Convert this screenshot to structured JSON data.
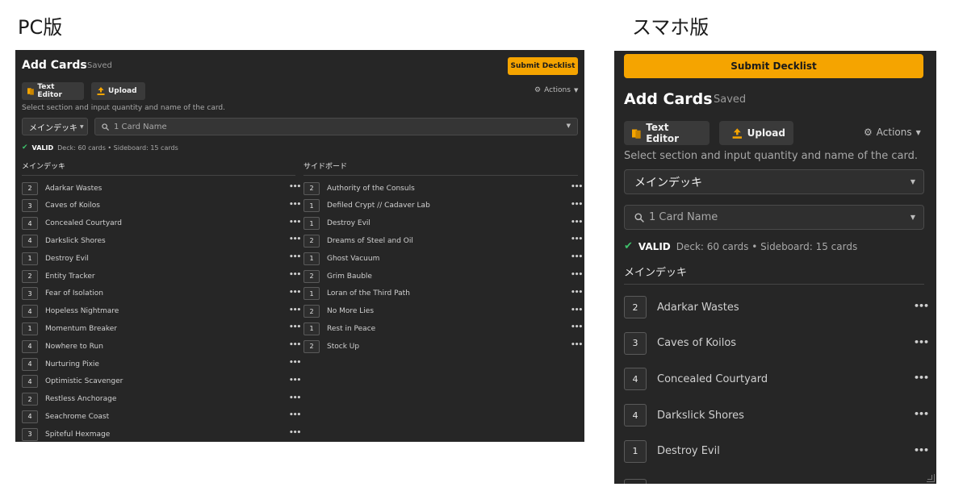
{
  "captions": {
    "pc": "PC版",
    "sp": "スマホ版"
  },
  "pc": {
    "title": "Add Cards",
    "saved": "Saved",
    "submit_label": "Submit Decklist",
    "text_editor_label": "Text Editor",
    "upload_label": "Upload",
    "actions_label": "Actions",
    "hint": "Select section and input quantity and name of the card.",
    "section_select": "メインデッキ",
    "search_placeholder": "1 Card Name",
    "valid_label": "VALID",
    "deck_info": "Deck: 60 cards • Sideboard: 15 cards",
    "main_heading": "メインデッキ",
    "side_heading": "サイドボード",
    "main_cards": [
      {
        "qty": "2",
        "name": "Adarkar Wastes"
      },
      {
        "qty": "3",
        "name": "Caves of Koilos"
      },
      {
        "qty": "4",
        "name": "Concealed Courtyard"
      },
      {
        "qty": "4",
        "name": "Darkslick Shores"
      },
      {
        "qty": "1",
        "name": "Destroy Evil"
      },
      {
        "qty": "2",
        "name": "Entity Tracker"
      },
      {
        "qty": "3",
        "name": "Fear of Isolation"
      },
      {
        "qty": "4",
        "name": "Hopeless Nightmare"
      },
      {
        "qty": "1",
        "name": "Momentum Breaker"
      },
      {
        "qty": "4",
        "name": "Nowhere to Run"
      },
      {
        "qty": "4",
        "name": "Nurturing Pixie"
      },
      {
        "qty": "4",
        "name": "Optimistic Scavenger"
      },
      {
        "qty": "2",
        "name": "Restless Anchorage"
      },
      {
        "qty": "4",
        "name": "Seachrome Coast"
      },
      {
        "qty": "3",
        "name": "Spiteful Hexmage"
      }
    ],
    "side_cards": [
      {
        "qty": "2",
        "name": "Authority of the Consuls"
      },
      {
        "qty": "1",
        "name": "Defiled Crypt // Cadaver Lab"
      },
      {
        "qty": "1",
        "name": "Destroy Evil"
      },
      {
        "qty": "2",
        "name": "Dreams of Steel and Oil"
      },
      {
        "qty": "1",
        "name": "Ghost Vacuum"
      },
      {
        "qty": "2",
        "name": "Grim Bauble"
      },
      {
        "qty": "1",
        "name": "Loran of the Third Path"
      },
      {
        "qty": "2",
        "name": "No More Lies"
      },
      {
        "qty": "1",
        "name": "Rest in Peace"
      },
      {
        "qty": "2",
        "name": "Stock Up"
      }
    ]
  },
  "sp": {
    "submit_label": "Submit Decklist",
    "title": "Add Cards",
    "saved": "Saved",
    "text_editor_label": "Text Editor",
    "upload_label": "Upload",
    "actions_label": "Actions",
    "hint": "Select section and input quantity and name of the card.",
    "section_select": "メインデッキ",
    "search_placeholder": "1 Card Name",
    "valid_label": "VALID",
    "deck_info": "Deck: 60 cards • Sideboard: 15 cards",
    "main_heading": "メインデッキ",
    "main_cards": [
      {
        "qty": "2",
        "name": "Adarkar Wastes"
      },
      {
        "qty": "3",
        "name": "Caves of Koilos"
      },
      {
        "qty": "4",
        "name": "Concealed Courtyard"
      },
      {
        "qty": "4",
        "name": "Darkslick Shores"
      },
      {
        "qty": "1",
        "name": "Destroy Evil"
      }
    ]
  },
  "colors": {
    "accent": "#f5a400",
    "panel_bg": "#262626",
    "valid": "#3ec16b"
  },
  "icons": [
    "cards-icon",
    "upload-icon",
    "gear-icon",
    "search-icon",
    "chevron-down-icon",
    "check-icon",
    "more-icon"
  ]
}
